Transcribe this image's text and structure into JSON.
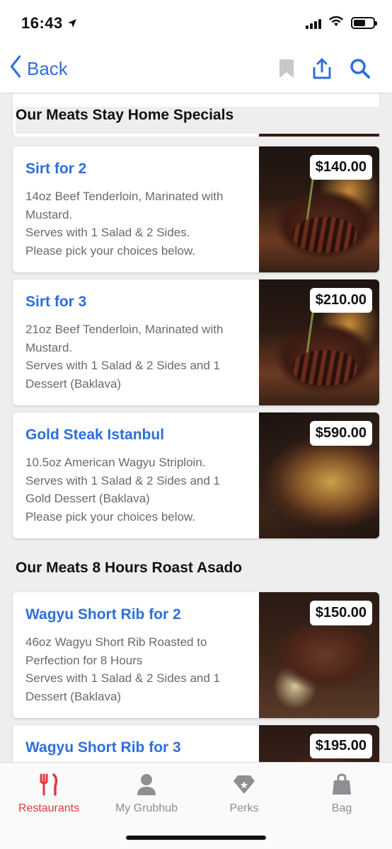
{
  "status_bar": {
    "time": "16:43"
  },
  "nav": {
    "back_label": "Back"
  },
  "sections": [
    {
      "title": "Our Meats Stay Home Specials"
    },
    {
      "title": "Our Meats 8 Hours Roast Asado"
    }
  ],
  "items": [
    {
      "name": "Sirt for 2",
      "description": "14oz Beef Tenderloin, Marinated with\nMustard.\nServes with 1 Salad & 2 Sides.\nPlease pick your choices below.",
      "price": "$140.00"
    },
    {
      "name": "Sirt for 3",
      "description": "21oz Beef Tenderloin, Marinated with\nMustard.\nServes with 1 Salad & 2 Sides and 1\nDessert (Baklava)",
      "price": "$210.00"
    },
    {
      "name": "Gold Steak Istanbul",
      "description": "10.5oz American Wagyu Striploin.\nServes with 1 Salad & 2 Sides and 1\nGold Dessert (Baklava)\nPlease pick your choices below.",
      "price": "$590.00"
    },
    {
      "name": "Wagyu Short Rib for 2",
      "description": "46oz Wagyu Short Rib Roasted to\nPerfection for 8 Hours\nServes with 1 Salad & 2 Sides and 1\nDessert (Baklava)",
      "price": "$150.00"
    },
    {
      "name": "Wagyu Short Rib for 3",
      "description": "",
      "price": "$195.00"
    }
  ],
  "tabs": [
    {
      "label": "Restaurants",
      "icon": "fork-knife-icon",
      "active": true
    },
    {
      "label": "My Grubhub",
      "icon": "person-icon",
      "active": false
    },
    {
      "label": "Perks",
      "icon": "diamond-icon",
      "active": false
    },
    {
      "label": "Bag",
      "icon": "bag-icon",
      "active": false
    }
  ],
  "colors": {
    "accent_blue": "#2e6fd9",
    "active_red": "#e03a3a",
    "inactive_gray": "#8e8e93"
  }
}
